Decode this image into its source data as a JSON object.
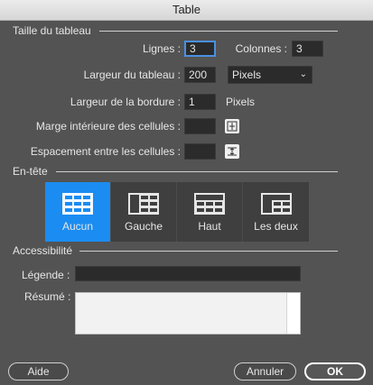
{
  "window": {
    "title": "Table"
  },
  "table_size": {
    "section_label": "Taille du tableau",
    "rows_label": "Lignes :",
    "rows_value": "3",
    "columns_label": "Colonnes :",
    "columns_value": "3",
    "width_label": "Largeur du tableau :",
    "width_value": "200",
    "width_unit": "Pixels",
    "border_label": "Largeur de la bordure :",
    "border_value": "1",
    "border_unit": "Pixels",
    "padding_label": "Marge intérieure des cellules :",
    "padding_value": "",
    "spacing_label": "Espacement entre les cellules :",
    "spacing_value": ""
  },
  "header": {
    "section_label": "En-tête",
    "options": [
      {
        "label": "Aucun",
        "icon": "table-no-header-icon",
        "selected": true
      },
      {
        "label": "Gauche",
        "icon": "table-left-header-icon",
        "selected": false
      },
      {
        "label": "Haut",
        "icon": "table-top-header-icon",
        "selected": false
      },
      {
        "label": "Les deux",
        "icon": "table-both-header-icon",
        "selected": false
      }
    ]
  },
  "accessibility": {
    "section_label": "Accessibilité",
    "caption_label": "Légende :",
    "caption_value": "",
    "summary_label": "Résumé :",
    "summary_value": ""
  },
  "footer": {
    "help_label": "Aide",
    "cancel_label": "Annuler",
    "ok_label": "OK"
  },
  "colors": {
    "background": "#535353",
    "accent": "#1b8cf2",
    "field": "#2b2b2b"
  }
}
